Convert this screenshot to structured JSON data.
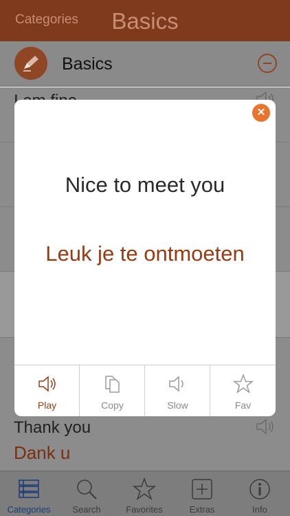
{
  "nav": {
    "back_label": "Categories",
    "title": "Basics"
  },
  "category": {
    "name": "Basics",
    "icon": "pencil-icon"
  },
  "list": {
    "rows": [
      {
        "native": "I am fine",
        "foreign": ""
      },
      {
        "native": "",
        "foreign": ""
      },
      {
        "native": "",
        "foreign": ""
      },
      {
        "native": "",
        "foreign": ""
      },
      {
        "native": "Thank you",
        "foreign": "Dank u"
      }
    ]
  },
  "popup": {
    "native": "Nice to meet you",
    "foreign": "Leuk je te ontmoeten",
    "actions": [
      {
        "label": "Play",
        "icon": "speaker-icon"
      },
      {
        "label": "Copy",
        "icon": "copy-icon"
      },
      {
        "label": "Slow",
        "icon": "speaker-icon"
      },
      {
        "label": "Fav",
        "icon": "star-icon"
      }
    ]
  },
  "tabs": [
    {
      "label": "Categories",
      "icon": "list-icon",
      "active": true
    },
    {
      "label": "Search",
      "icon": "search-icon",
      "active": false
    },
    {
      "label": "Favorites",
      "icon": "star-icon",
      "active": false
    },
    {
      "label": "Extras",
      "icon": "plus-box-icon",
      "active": false
    },
    {
      "label": "Info",
      "icon": "info-icon",
      "active": false
    }
  ],
  "colors": {
    "accent": "#7f3a1d",
    "foreign_text": "#9a3a12",
    "close_button": "#e8742e",
    "active_tab": "#1a3a78"
  }
}
